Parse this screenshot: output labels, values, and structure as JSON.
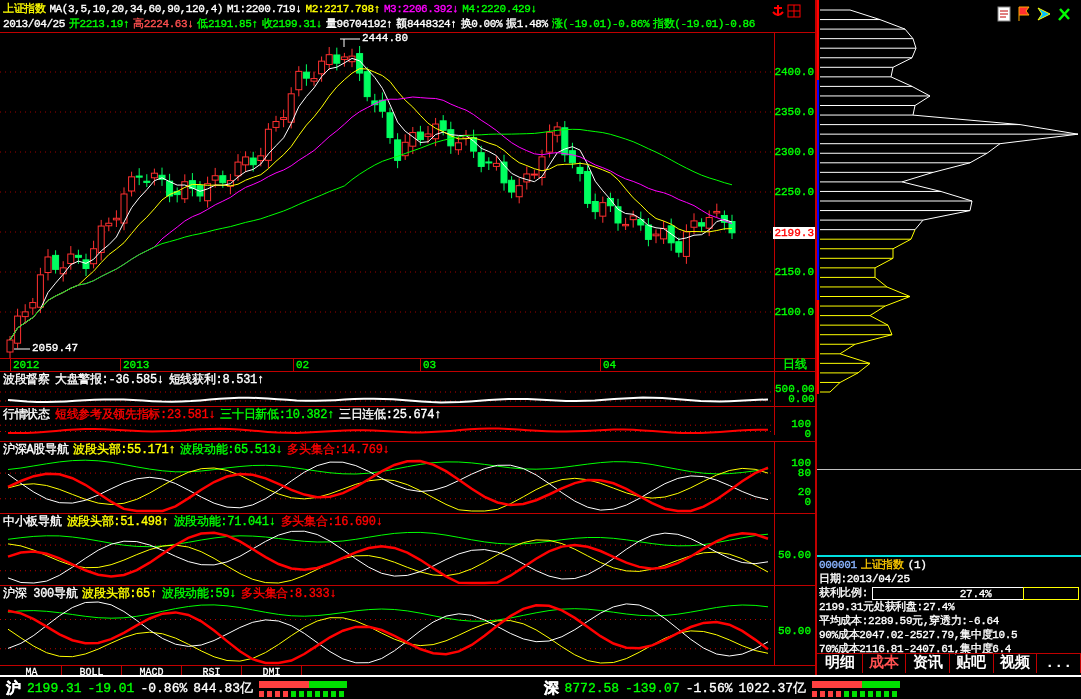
{
  "header": {
    "title": "上证指数",
    "ma_params": "MA(3,5,10,20,34,60,90,120,4)",
    "ma_values": [
      {
        "text": "M1:2200.719↓",
        "color": "#ffffff"
      },
      {
        "text": "M2:2217.798↑",
        "color": "#ffff00"
      },
      {
        "text": "M3:2206.392↓",
        "color": "#ff00ff"
      },
      {
        "text": "M4:2220.429↓",
        "color": "#00ff00"
      }
    ],
    "quote": [
      {
        "text": "2013/04/25",
        "color": "#ffffff"
      },
      {
        "text": "开2213.19↑",
        "color": "#00ff00"
      },
      {
        "text": "高2224.63↓",
        "color": "#ff5050"
      },
      {
        "text": "低2191.85↑",
        "color": "#00ff00"
      },
      {
        "text": "收2199.31↓",
        "color": "#00ff00"
      },
      {
        "text": "量96704192↑",
        "color": "#ffffff"
      },
      {
        "text": "额8448324↑",
        "color": "#ffffff"
      },
      {
        "text": "换0.00%",
        "color": "#ffffff"
      },
      {
        "text": "振1.48%",
        "color": "#ffffff"
      },
      {
        "text": "涨(-19.01)-0.86%",
        "color": "#00ff00"
      },
      {
        "text": "指数(-19.01)-0.86",
        "color": "#00ff00"
      }
    ]
  },
  "chart": {
    "high_note": "2444.80",
    "low_note": "2059.47",
    "price_labels": [
      "2400.0",
      "2350.0",
      "2300.0",
      "2250.0",
      "2150.0",
      "2100.0"
    ],
    "current_price": "2199.3",
    "date_labels": [
      "2012",
      "2013",
      "02",
      "03",
      "04"
    ],
    "period": "日线"
  },
  "indicators": [
    {
      "title": "波段督察",
      "items": [
        {
          "text": "大盘警报:-36.585↓",
          "color": "#ffffff"
        },
        {
          "text": "短线获利:8.531↑",
          "color": "#ffffff"
        }
      ],
      "axis": [
        [
          "500.00",
          "0.00"
        ]
      ]
    },
    {
      "title": "行情状态",
      "items": [
        {
          "text": "短线参考及领先指标:23.581↓",
          "color": "#ff0000"
        },
        {
          "text": "三十日新低:10.382↑",
          "color": "#00ff00"
        },
        {
          "text": "三日连低:25.674↑",
          "color": "#ffffff"
        }
      ],
      "axis": [
        [
          "100",
          "0"
        ]
      ]
    },
    {
      "title": "沪深A股导航",
      "items": [
        {
          "text": "波段头部:55.171↑",
          "color": "#ffff00"
        },
        {
          "text": "波段动能:65.513↓",
          "color": "#00ff00"
        },
        {
          "text": "多头集合:14.769↓",
          "color": "#ff0000"
        }
      ],
      "axis": [
        [
          "100",
          "80"
        ],
        [
          "20",
          "0"
        ]
      ]
    },
    {
      "title": "中小板导航",
      "items": [
        {
          "text": "波段头部:51.498↑",
          "color": "#ffff00"
        },
        {
          "text": "波段动能:71.041↓",
          "color": "#00ff00"
        },
        {
          "text": "多头集合:16.690↓",
          "color": "#ff0000"
        }
      ],
      "axis": [
        [
          "50.00"
        ]
      ]
    },
    {
      "title": "沪深 300导航",
      "items": [
        {
          "text": "波段头部:65↑",
          "color": "#ffff00"
        },
        {
          "text": "波段动能:59↓",
          "color": "#00ff00"
        },
        {
          "text": "多头集合:8.333↓",
          "color": "#ff0000"
        }
      ],
      "axis": [
        [
          "50.00"
        ]
      ]
    }
  ],
  "indicator_tabs": [
    {
      "label": "MA",
      "selected": false
    },
    {
      "label": "BOLL",
      "selected": false
    },
    {
      "label": "MACD",
      "selected": false
    },
    {
      "label": "RSI",
      "selected": false
    },
    {
      "label": "DMI",
      "selected": false
    }
  ],
  "cost_panel": {
    "code": "000001",
    "name": "上证指数",
    "suffix": "(1)",
    "date": "日期:2013/04/25",
    "profit_label": "获利比例:",
    "profit_value": "27.4%",
    "level": 0.274,
    "lines": [
      "2199.31元处获利盘:27.4%",
      "平均成本:2289.59元,穿透力:-6.64",
      "90%成本2047.02-2527.79,集中度10.5",
      "70%成本2116.81-2407.61,集中度6.4"
    ]
  },
  "side_tabs": [
    {
      "label": "明细",
      "selected": false
    },
    {
      "label": "成本",
      "selected": true
    },
    {
      "label": "资讯",
      "selected": false
    },
    {
      "label": "贴吧",
      "selected": false
    },
    {
      "label": "视频",
      "selected": false
    },
    {
      "label": "...",
      "selected": false
    }
  ],
  "status_bar": [
    {
      "market": "沪",
      "price": "2199.31",
      "change": "-19.01",
      "percent": "-0.86%",
      "amount": "844.83亿"
    },
    {
      "market": "深",
      "price": "8772.58",
      "change": "-139.07",
      "percent": "-1.56%",
      "amount": "1022.37亿"
    }
  ]
}
